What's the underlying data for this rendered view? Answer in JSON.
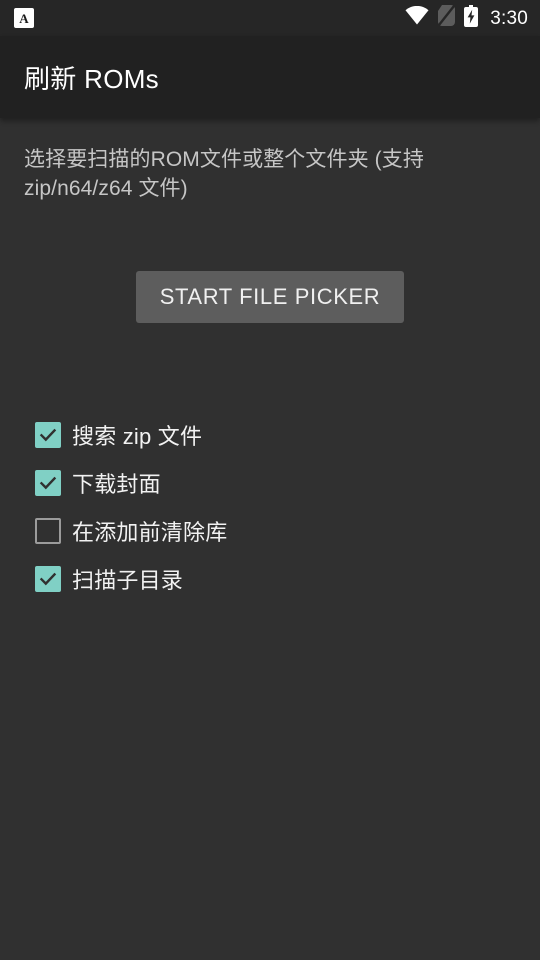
{
  "status_bar": {
    "notification_badge": "A",
    "notification_icon": "app-notification-icon",
    "wifi_icon": "wifi-full-icon",
    "sim_icon": "no-sim-card-icon",
    "battery_icon": "battery-charging-icon",
    "time": "3:30"
  },
  "app_bar": {
    "title": "刷新 ROMs"
  },
  "main": {
    "description": "选择要扫描的ROM文件或整个文件夹 (支持 zip/n64/z64 文件)",
    "primary_button": "START FILE PICKER",
    "options": [
      {
        "label": "搜索 zip 文件",
        "checked": true
      },
      {
        "label": "下载封面",
        "checked": true
      },
      {
        "label": "在添加前清除库",
        "checked": false
      },
      {
        "label": "扫描子目录",
        "checked": true
      }
    ]
  },
  "colors": {
    "status_bar_bg": "#262626",
    "app_bar_bg": "#212121",
    "page_bg": "#303030",
    "accent_checkbox": "#80d0c5",
    "button_bg": "#5d5d5d",
    "text_primary": "#ffffff",
    "text_secondary": "#c6c6c6",
    "checkbox_outline": "#9b9b9b"
  }
}
